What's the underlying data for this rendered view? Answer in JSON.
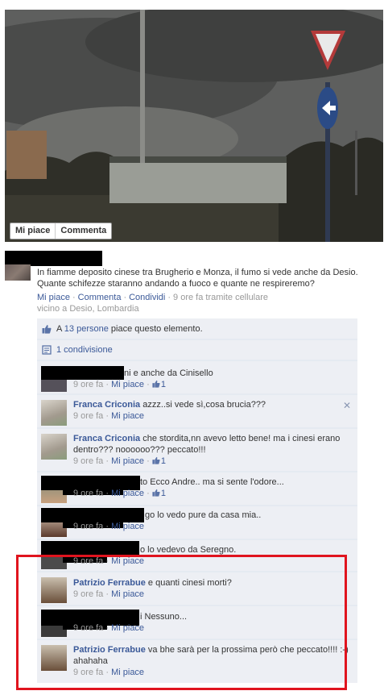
{
  "photo": {
    "like_label": "Mi piace",
    "comment_label": "Commenta"
  },
  "post": {
    "text": "In fiamme deposito cinese tra Brugherio e Monza, il fumo si vede anche da Desio. Quante schifezze staranno andando a fuoco e quante ne respireremo?",
    "actions": [
      "Mi piace",
      "Commenta",
      "Condividi"
    ],
    "time": "9 ore fa tramite cellulare",
    "location": "vicino a Desio, Lombardia"
  },
  "likes": {
    "prefix": "A ",
    "people": "13 persone",
    "suffix": " piace questo elemento."
  },
  "shares": {
    "label": "1 condivisione"
  },
  "comments": [
    {
      "name": "",
      "text": "ni e anche da Cinisello",
      "time": "9 ore fa",
      "like": "Mi piace",
      "count": "1"
    },
    {
      "name": "Franca Criconia",
      "text": " azzz..si vede sì,cosa brucia???",
      "time": "9 ore fa",
      "like": "Mi piace",
      "count": ""
    },
    {
      "name": "Franca Criconia",
      "text": " che stordita,nn avevo letto bene! ma i cinesi erano dentro??? noooooo??? peccato!!!",
      "time": "9 ore fa",
      "like": "Mi piace",
      "count": "1"
    },
    {
      "name": "",
      "text": "to Ecco Andre.. ma si sente l'odore...",
      "time": "9 ore fa",
      "like": "Mi piace",
      "count": "1"
    },
    {
      "name": "",
      "text": "go lo vedo pure da casa mia..",
      "time": "9 ore fa",
      "like": "Mi piace",
      "count": ""
    },
    {
      "name": "",
      "text": "o lo vedevo da Seregno.",
      "time": "9 ore fa",
      "like": "Mi piace",
      "count": ""
    },
    {
      "name": "Patrizio Ferrabue",
      "text": " e quanti cinesi morti?",
      "time": "9 ore fa",
      "like": "Mi piace",
      "count": ""
    },
    {
      "name": "",
      "text": "i Nessuno...",
      "time": "9 ore fa",
      "like": "Mi piace",
      "count": ""
    },
    {
      "name": "Patrizio Ferrabue",
      "text": " va bhe sarà per la prossima però che peccato!!!! :-) ahahaha",
      "time": "9 ore fa",
      "like": "Mi piace",
      "count": ""
    }
  ],
  "colors": {
    "link": "#3b5998",
    "ufi_background": "#edeff4",
    "highlight_border": "#e0141e"
  },
  "icons": [
    "like-thumb-icon",
    "share-icon",
    "close-icon",
    "yield-sign",
    "arrow-sign"
  ]
}
